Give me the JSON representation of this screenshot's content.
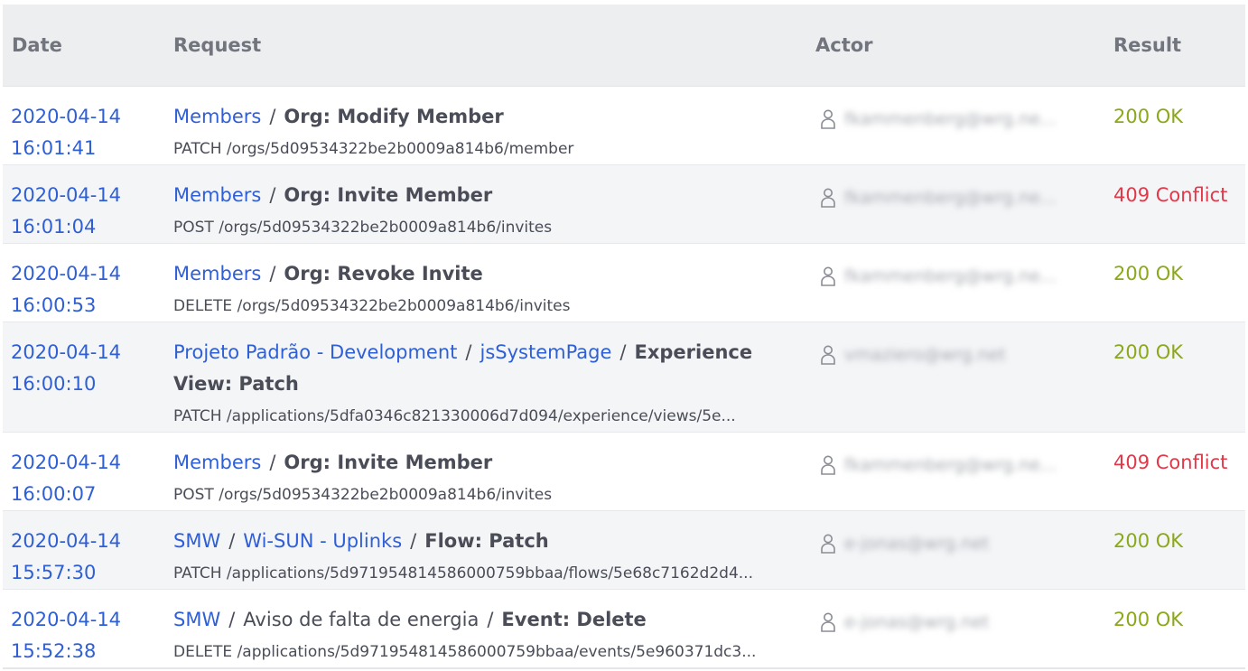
{
  "columns": [
    "Date",
    "Request",
    "Actor",
    "Result"
  ],
  "colors": {
    "link": "#2f5fd6",
    "ok": "#8aa81a",
    "conflict": "#e0394a"
  },
  "rows": [
    {
      "date": "2020-04-14",
      "time": "16:01:41",
      "crumbs": [
        {
          "text": "Members",
          "link": true
        }
      ],
      "action": "Org: Modify Member",
      "path": "PATCH /orgs/5d09534322be2b0009a814b6/member",
      "actor": "fkammenberg@wrg.ne...",
      "result": "200 OK",
      "status": "ok"
    },
    {
      "date": "2020-04-14",
      "time": "16:01:04",
      "crumbs": [
        {
          "text": "Members",
          "link": true
        }
      ],
      "action": "Org: Invite Member",
      "path": "POST /orgs/5d09534322be2b0009a814b6/invites",
      "actor": "fkammenberg@wrg.ne...",
      "result": "409 Conflict",
      "status": "conflict"
    },
    {
      "date": "2020-04-14",
      "time": "16:00:53",
      "crumbs": [
        {
          "text": "Members",
          "link": true
        }
      ],
      "action": "Org: Revoke Invite",
      "path": "DELETE /orgs/5d09534322be2b0009a814b6/invites",
      "actor": "fkammenberg@wrg.ne...",
      "result": "200 OK",
      "status": "ok"
    },
    {
      "date": "2020-04-14",
      "time": "16:00:10",
      "crumbs": [
        {
          "text": "Projeto Padrão - Development",
          "link": true
        },
        {
          "text": "jsSystemPage",
          "link": true
        }
      ],
      "action": "Experience View: Patch",
      "path": "PATCH /applications/5dfa0346c821330006d7d094/experience/views/5e...",
      "actor": "vmaziero@wrg.net",
      "result": "200 OK",
      "status": "ok"
    },
    {
      "date": "2020-04-14",
      "time": "16:00:07",
      "crumbs": [
        {
          "text": "Members",
          "link": true
        }
      ],
      "action": "Org: Invite Member",
      "path": "POST /orgs/5d09534322be2b0009a814b6/invites",
      "actor": "fkammenberg@wrg.ne...",
      "result": "409 Conflict",
      "status": "conflict"
    },
    {
      "date": "2020-04-14",
      "time": "15:57:30",
      "crumbs": [
        {
          "text": "SMW",
          "link": true
        },
        {
          "text": "Wi-SUN - Uplinks",
          "link": true
        }
      ],
      "action": "Flow: Patch",
      "path": "PATCH /applications/5d971954814586000759bbaa/flows/5e68c7162d2d4...",
      "actor": "e-jonas@wrg.net",
      "result": "200 OK",
      "status": "ok"
    },
    {
      "date": "2020-04-14",
      "time": "15:52:38",
      "crumbs": [
        {
          "text": "SMW",
          "link": true
        },
        {
          "text": "Aviso de falta de energia",
          "link": false
        }
      ],
      "action": "Event: Delete",
      "path": "DELETE /applications/5d971954814586000759bbaa/events/5e960371dc3...",
      "actor": "e-jonas@wrg.net",
      "result": "200 OK",
      "status": "ok"
    }
  ]
}
